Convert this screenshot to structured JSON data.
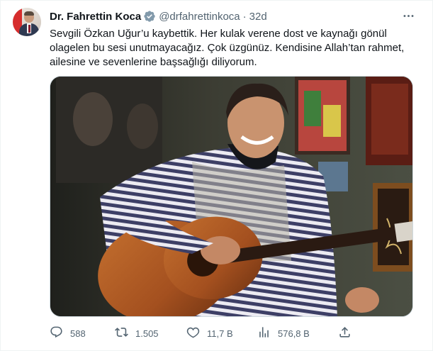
{
  "tweet": {
    "author_name": "Dr. Fahrettin Koca",
    "handle": "@drfahrettinkoca",
    "separator": "·",
    "time": "32d",
    "text": "Sevgili Özkan Uğur’u kaybettik. Her kulak verene dost ve kaynağı gönül olagelen bu sesi unutmayacağız. Çok üzgünüz. Kendisine Allah’tan rahmet, ailesine ve sevenlerine başsağlığı diliyorum."
  },
  "actions": {
    "replies": "588",
    "retweets": "1.505",
    "likes": "11,7 B",
    "views": "576,8 B"
  },
  "icons": {
    "verified": "verified-badge-icon",
    "more": "more-icon",
    "reply": "reply-icon",
    "retweet": "retweet-icon",
    "like": "heart-icon",
    "views": "views-icon",
    "share": "share-icon"
  },
  "colors": {
    "text": "#0f1419",
    "secondary": "#536471",
    "verified": "#829aab",
    "border": "#eff3f4"
  }
}
